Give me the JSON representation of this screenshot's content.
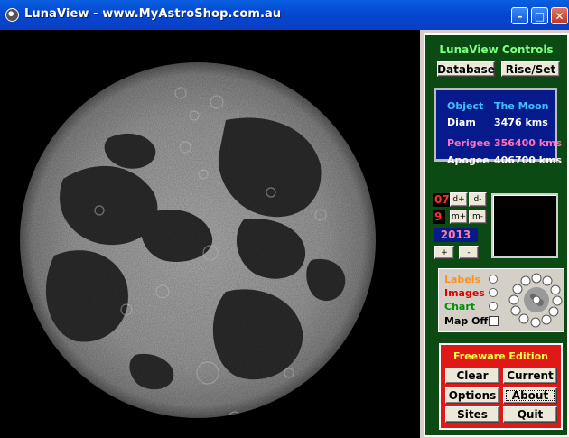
{
  "window": {
    "title": "LunaView - www.MyAstroShop.com.au",
    "minimize_glyph": "–",
    "maximize_glyph": "□",
    "close_glyph": "✕"
  },
  "controls": {
    "title": "LunaView Controls",
    "database_label": "Database",
    "rise_set_label": "Rise/Set"
  },
  "info": {
    "object_label": "Object",
    "object_value": "The Moon",
    "diam_label": "Diam",
    "diam_value": "3476 kms",
    "perigee_label": "Perigee",
    "perigee_value": "356400 kms",
    "apogee_label": "Apogee",
    "apogee_value": "406700 kms"
  },
  "date": {
    "day": "07",
    "month": "9",
    "year": "2013",
    "day_plus": "d+",
    "day_minus": "d-",
    "month_plus": "m+",
    "month_minus": "m-",
    "year_plus": "+",
    "year_minus": "-"
  },
  "options": {
    "labels": "Labels",
    "images": "Images",
    "chart": "Chart",
    "map_off": "Map Off"
  },
  "freeware": {
    "title": "Freeware Edition",
    "clear": "Clear",
    "current": "Current",
    "options": "Options",
    "about": "About",
    "sites": "Sites",
    "quit": "Quit"
  },
  "colors": {
    "labels": "#ff9020",
    "images": "#e00000",
    "chart": "#009000",
    "map_off": "#000000",
    "object_label": "#40c0ff",
    "info_text": "#ffffff",
    "perigee": "#ff70c0"
  }
}
